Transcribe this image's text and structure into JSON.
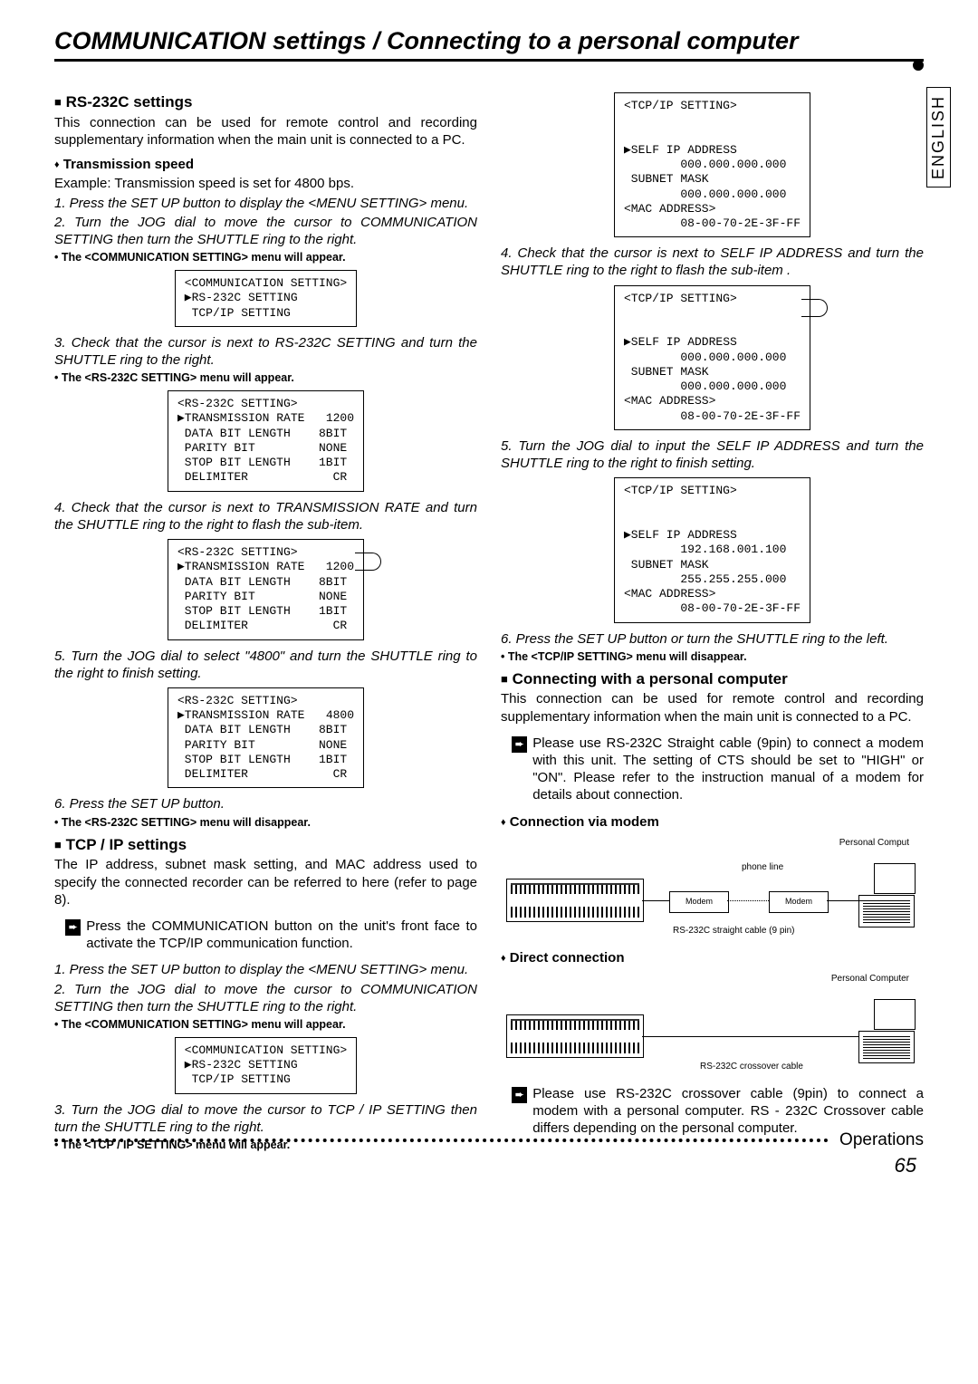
{
  "title": "COMMUNICATION settings /  Connecting to a personal computer",
  "lang_tab": "ENGLISH",
  "footer_label": "Operations",
  "page_number": "65",
  "left": {
    "h_rs232": "RS-232C settings",
    "rs232_intro": "This connection can be used for remote control and recording supplementary information when the main unit is connected to a PC.",
    "h_tx": "Transmission speed",
    "tx_ex": "Example: Transmission speed is set for 4800 bps.",
    "s1": "1. Press the SET UP button to display the <MENU SETTING> menu.",
    "s2": "2. Turn the JOG dial to move the cursor to COMMUNICATION SETTING then turn the SHUTTLE ring to the right.",
    "b_comm_appear": "• The <COMMUNICATION SETTING> menu will appear.",
    "osd_comm": "<COMMUNICATION SETTING>\n▶RS-232C SETTING\n TCP/IP SETTING",
    "s3": "3. Check that the cursor is next to RS-232C SETTING and turn the SHUTTLE ring to the right.",
    "b_rs232_appear": "• The <RS-232C SETTING> menu will appear.",
    "osd_rs1": "<RS-232C SETTING>\n▶TRANSMISSION RATE   1200\n DATA BIT LENGTH    8BIT\n PARITY BIT         NONE\n STOP BIT LENGTH    1BIT\n DELIMITER            CR",
    "s4": "4. Check that the cursor is next to TRANSMISSION RATE and turn the SHUTTLE ring to the right to flash the sub-item.",
    "osd_rs2": "<RS-232C SETTING>\n▶TRANSMISSION RATE   1200\n DATA BIT LENGTH    8BIT\n PARITY BIT         NONE\n STOP BIT LENGTH    1BIT\n DELIMITER            CR",
    "s5": "5. Turn the JOG dial to select \"4800\" and turn the SHUTTLE ring to the right to finish setting.",
    "osd_rs3": "<RS-232C SETTING>\n▶TRANSMISSION RATE   4800\n DATA BIT LENGTH    8BIT\n PARITY BIT         NONE\n STOP BIT LENGTH    1BIT\n DELIMITER            CR",
    "s6": "6. Press the SET UP button.",
    "b_rs232_disappear": "• The <RS-232C SETTING> menu will disappear.",
    "h_tcpip": "TCP / IP settings",
    "tcpip_intro": "The IP address, subnet mask setting, and MAC address used to specify the connected recorder can be referred to here (refer to page 8).",
    "note_comm_btn": "Press the COMMUNICATION button on the unit's front face to activate the TCP/IP communication function.",
    "t1": "1. Press the SET UP button to display the <MENU SETTING> menu.",
    "t2": "2. Turn the JOG dial to move the cursor to COMMUNICATION SETTING then turn the SHUTTLE ring to the right.",
    "b_comm_appear2": "• The <COMMUNICATION SETTING> menu will appear.",
    "osd_comm2": "<COMMUNICATION SETTING>\n▶RS-232C SETTING\n TCP/IP SETTING",
    "t3": "3. Turn the JOG dial to move the cursor to TCP / IP SETTING then turn the SHUTTLE ring to the right.",
    "b_tcpip_appear": "• The <TCP / IP SETTING> menu will appear."
  },
  "right": {
    "osd_ip1": "<TCP/IP SETTING>\n\n\n▶SELF IP ADDRESS\n        000.000.000.000\n SUBNET MASK\n        000.000.000.000\n<MAC ADDRESS>\n        08-00-70-2E-3F-FF",
    "r4": "4. Check that the cursor is next to SELF IP ADDRESS and turn the SHUTTLE ring to the right to flash the sub-item .",
    "osd_ip2": "<TCP/IP SETTING>\n\n\n▶SELF IP ADDRESS\n        000.000.000.000\n SUBNET MASK\n        000.000.000.000\n<MAC ADDRESS>\n        08-00-70-2E-3F-FF",
    "r5": "5. Turn the JOG dial to input the SELF IP ADDRESS and turn the SHUTTLE ring to the right to finish setting.",
    "osd_ip3": "<TCP/IP SETTING>\n\n\n▶SELF IP ADDRESS\n        192.168.001.100\n SUBNET MASK\n        255.255.255.000\n<MAC ADDRESS>\n        08-00-70-2E-3F-FF",
    "r6": "6. Press the SET UP button or turn the SHUTTLE ring to the left.",
    "b_tcpip_disappear": "• The <TCP/IP SETTING> menu will disappear.",
    "h_connecting": "Connecting with a personal computer",
    "conn_intro": "This connection can be used for remote control and recording supplementary information when the main unit is connected to a PC.",
    "note_straight": "Please use RS-232C Straight cable (9pin) to connect a modem with this unit. The setting of CTS should be set to \"HIGH\" or \"ON\". Please refer to the instruction manual of a modem for details about connection.",
    "h_modem": "Connection via modem",
    "h_direct": "Direct connection",
    "note_crossover": "Please use RS-232C crossover cable (9pin) to connect a modem with a personal computer. RS - 232C Crossover cable differs depending on the personal computer.",
    "diagram": {
      "pc_label": "Personal Computer",
      "short_pc_label": "Personal Comput",
      "phone_line": "phone line",
      "modem": "Modem",
      "straight_cable": "RS-232C straight cable (9 pin)",
      "crossover_cable": "RS-232C crossover cable"
    }
  }
}
